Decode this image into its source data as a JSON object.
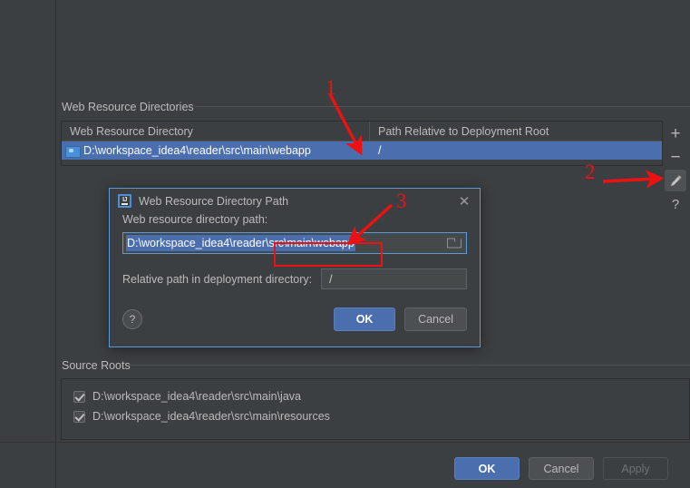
{
  "window": {
    "background_color": "#3c3f41",
    "accent_color": "#4b6eaf",
    "annotation_color": "#ee1111"
  },
  "web_resource_directories": {
    "group_title": "Web Resource Directories",
    "columns": [
      "Web Resource Directory",
      "Path Relative to Deployment Root"
    ],
    "rows": [
      {
        "icon": "folder-icon",
        "directory": "D:\\workspace_idea4\\reader\\src\\main\\webapp",
        "relative_path": "/",
        "selected": true
      }
    ],
    "toolbar": [
      {
        "name": "add-button",
        "glyph": "+",
        "active": false
      },
      {
        "name": "remove-button",
        "glyph": "−",
        "active": false
      },
      {
        "name": "edit-button",
        "glyph": "pencil-icon",
        "active": true
      },
      {
        "name": "help-button",
        "glyph": "?",
        "active": false
      }
    ]
  },
  "dialog": {
    "title": "Web Resource Directory Path",
    "logo": "intellij-idea-icon",
    "close_label": "✕",
    "path_field_label": "Web resource directory path:",
    "path_field_value": "D:\\workspace_idea4\\reader\\src\\main\\webapp",
    "path_field_selected": true,
    "browse_icon": "folder-open-icon",
    "relative_label": "Relative path in deployment directory:",
    "relative_value": "/",
    "help_glyph": "?",
    "ok_label": "OK",
    "cancel_label": "Cancel"
  },
  "source_roots": {
    "group_title": "Source Roots",
    "items": [
      {
        "label": "D:\\workspace_idea4\\reader\\src\\main\\java",
        "checked": true
      },
      {
        "label": "D:\\workspace_idea4\\reader\\src\\main\\resources",
        "checked": true
      }
    ]
  },
  "footer": {
    "ok_label": "OK",
    "cancel_label": "Cancel",
    "apply_label": "Apply",
    "apply_disabled": true
  },
  "annotations": [
    {
      "number": "1",
      "target": "selected-web-resource-row"
    },
    {
      "number": "2",
      "target": "edit-button"
    },
    {
      "number": "3",
      "target": "highlighted-path-segment"
    }
  ],
  "highlight_box": {
    "text": "src\\main\\webapp"
  }
}
